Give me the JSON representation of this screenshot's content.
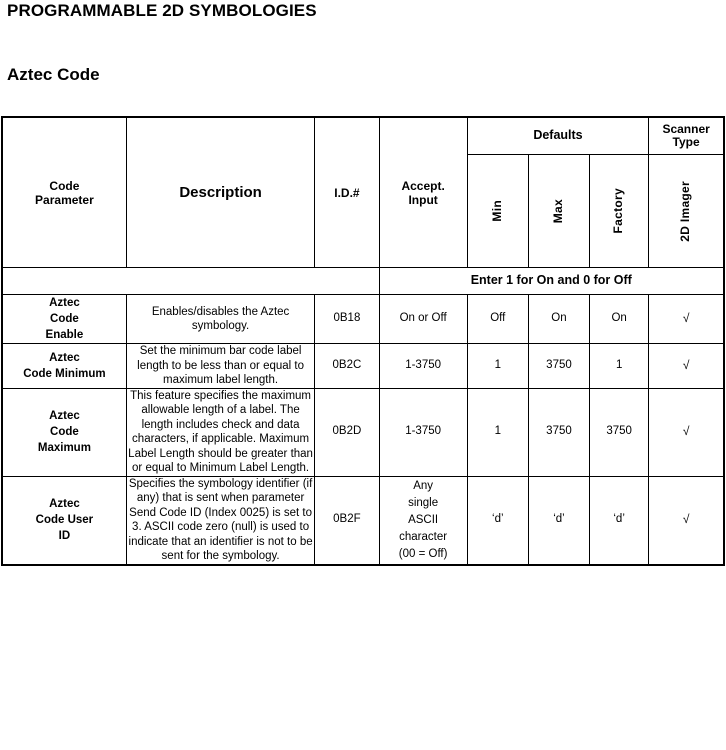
{
  "document": {
    "title": "PROGRAMMABLE 2D SYMBOLOGIES",
    "section": "Aztec Code"
  },
  "table": {
    "headers": {
      "code_parameter": "Code\nParameter",
      "code_parameter_line1": "Code",
      "code_parameter_line2": "Parameter",
      "description": "Description",
      "id_number": "I.D.#",
      "accept_input_line1": "Accept.",
      "accept_input_line2": "Input",
      "defaults": "Defaults",
      "min": "Min",
      "max": "Max",
      "factory": "Factory",
      "scanner_type_line1": "Scanner",
      "scanner_type_line2": "Type",
      "imager": "2D Imager"
    },
    "note": "Enter 1 for On and 0 for Off",
    "rows": [
      {
        "parameter_line1": "Aztec",
        "parameter_line2": "Code",
        "parameter_line3": "Enable",
        "description": "Enables/disables the Aztec symbology.",
        "id": "0B18",
        "accept_input": "On or Off",
        "min": "Off",
        "max": "On",
        "factory": "On",
        "imager": "√"
      },
      {
        "parameter_line1": "Aztec",
        "parameter_line2": "Code Minimum",
        "parameter_line3": "",
        "description": "Set the minimum bar code label length to be less than or equal to maximum label length.",
        "id": "0B2C",
        "accept_input": "1-3750",
        "min": "1",
        "max": "3750",
        "factory": "1",
        "imager": "√"
      },
      {
        "parameter_line1": "Aztec",
        "parameter_line2": "Code",
        "parameter_line3": "Maximum",
        "description": "This feature specifies the maximum allowable length of a label. The length includes check and data characters, if applicable. Maximum Label Length should be greater than or equal to Minimum Label Length.",
        "id": "0B2D",
        "accept_input": "1-3750",
        "min": "1",
        "max": "3750",
        "factory": "3750",
        "imager": "√"
      },
      {
        "parameter_line1": "Aztec",
        "parameter_line2": "Code User",
        "parameter_line3": "ID",
        "description": "Specifies the symbology identifier (if any) that is sent when parameter Send Code ID (Index 0025) is set to 3. ASCII code zero (null) is used to indicate that an identifier is not to be sent for the symbology.",
        "id": "0B2F",
        "accept_input_lines": [
          "Any",
          "single",
          "ASCII",
          "character",
          "(00 = Off)"
        ],
        "min": "‘d’",
        "max": "‘d’",
        "factory": "‘d’",
        "imager": "√"
      }
    ]
  }
}
